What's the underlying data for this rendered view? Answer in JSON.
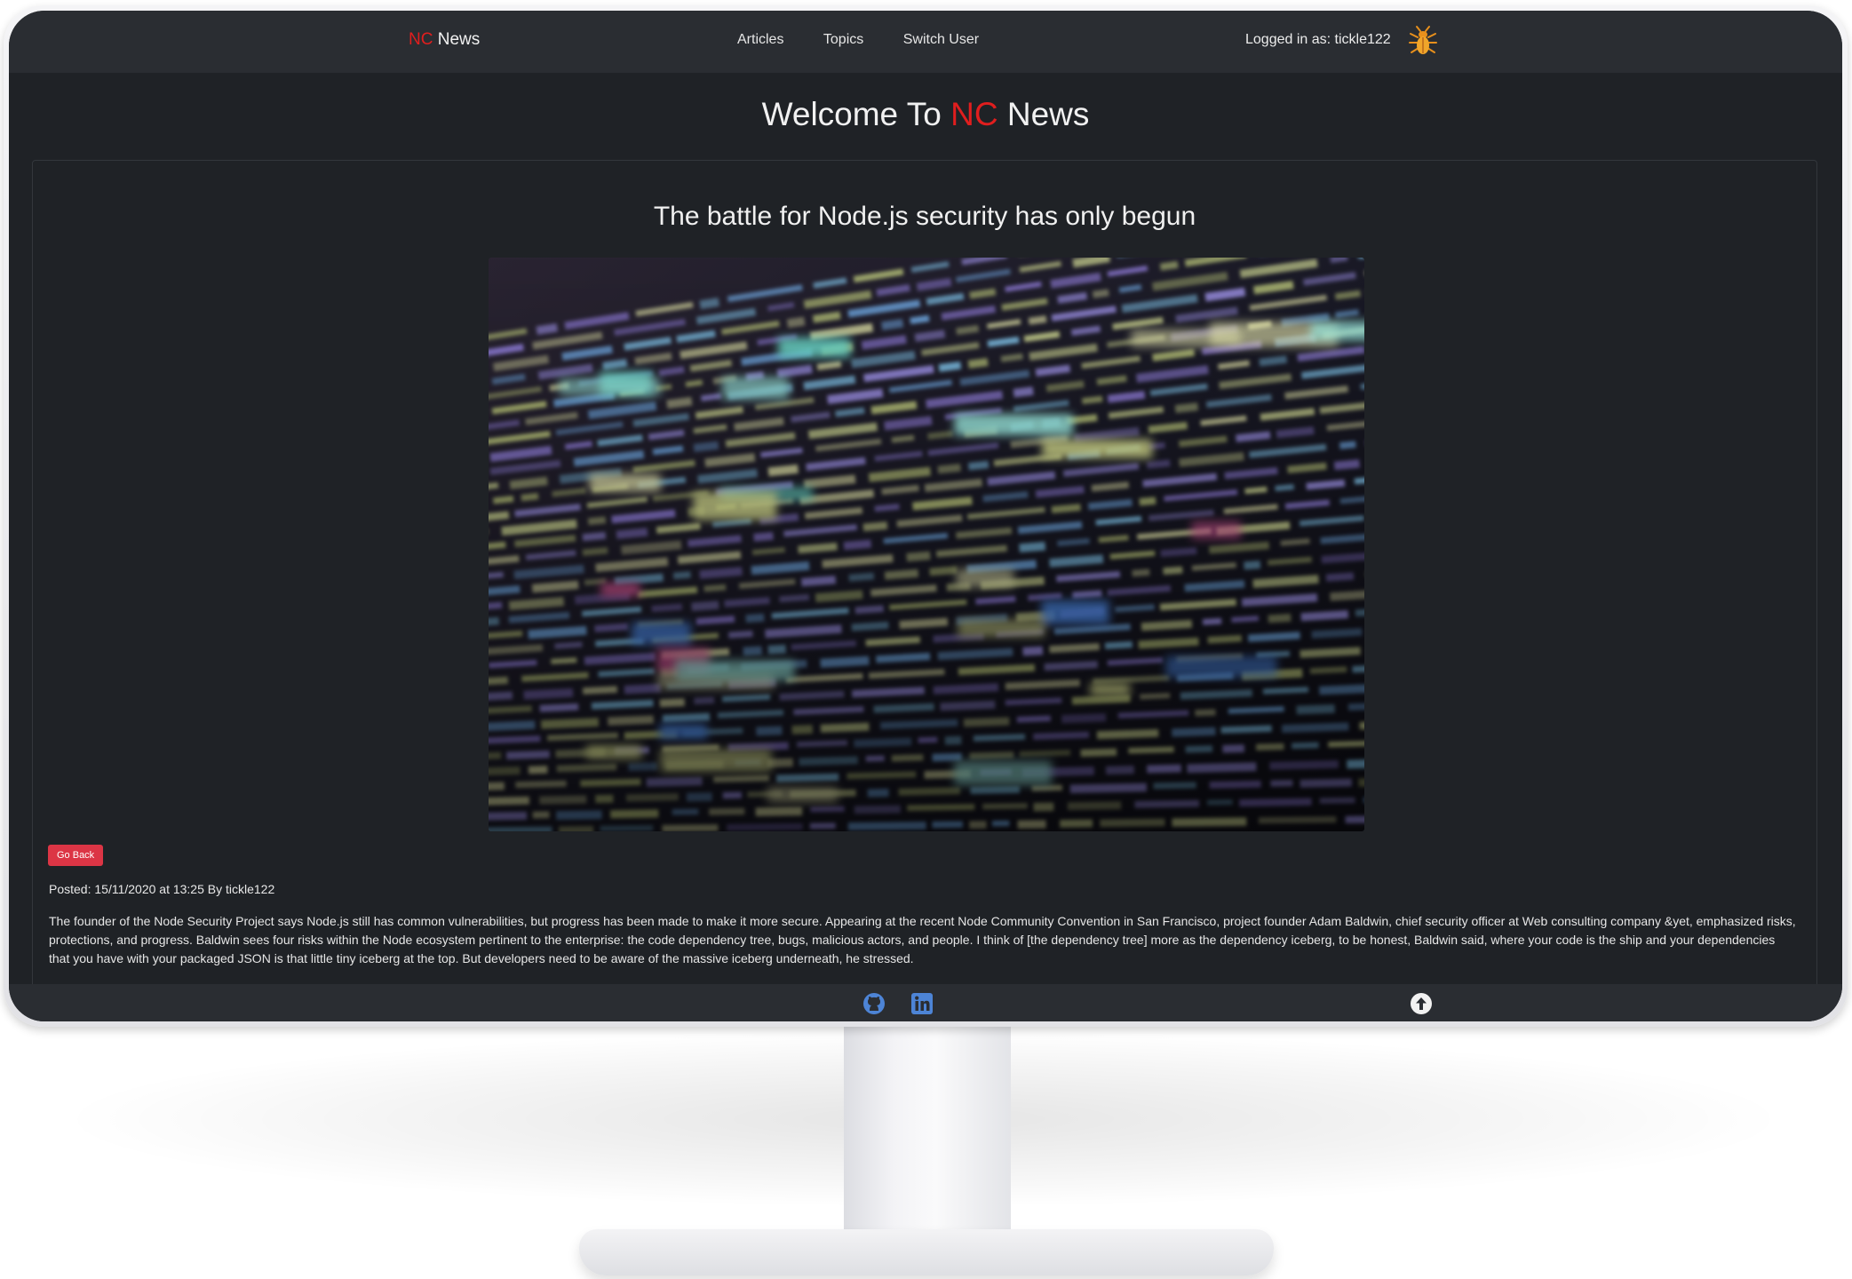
{
  "colors": {
    "accent": "#e01e1e",
    "button": "#dc3545",
    "background": "#1f2226",
    "navbar": "#2a2d32"
  },
  "navbar": {
    "brand_accent": "NC",
    "brand_rest": "News",
    "links": [
      "Articles",
      "Topics",
      "Switch User"
    ],
    "user_label": "Logged in as: tickle122",
    "avatar_icon": "bug-avatar-icon"
  },
  "welcome": {
    "prefix": "Welcome To",
    "accent": "NC",
    "suffix": "News"
  },
  "article": {
    "title": "The battle for Node.js security has only begun",
    "image_icon": "code-screen-image",
    "go_back_label": "Go Back",
    "posted": "Posted: 15/11/2020 at 13:25 By tickle122",
    "body": "The founder of the Node Security Project says Node.js still has common vulnerabilities, but progress has been made to make it more secure. Appearing at the recent Node Community Convention in San Francisco, project founder Adam Baldwin, chief security officer at Web consulting company &yet, emphasized risks, protections, and progress. Baldwin sees four risks within the Node ecosystem pertinent to the enterprise: the code dependency tree, bugs, malicious actors, and people. I think of [the dependency tree] more as the dependency iceberg, to be honest, Baldwin said, where your code is the ship and your dependencies that you have with your packaged JSON is that little tiny iceberg at the top. But developers need to be aware of the massive iceberg underneath, he stressed."
  },
  "footer": {
    "icons": [
      "github-icon",
      "linkedin-icon",
      "arrow-up-icon"
    ]
  }
}
